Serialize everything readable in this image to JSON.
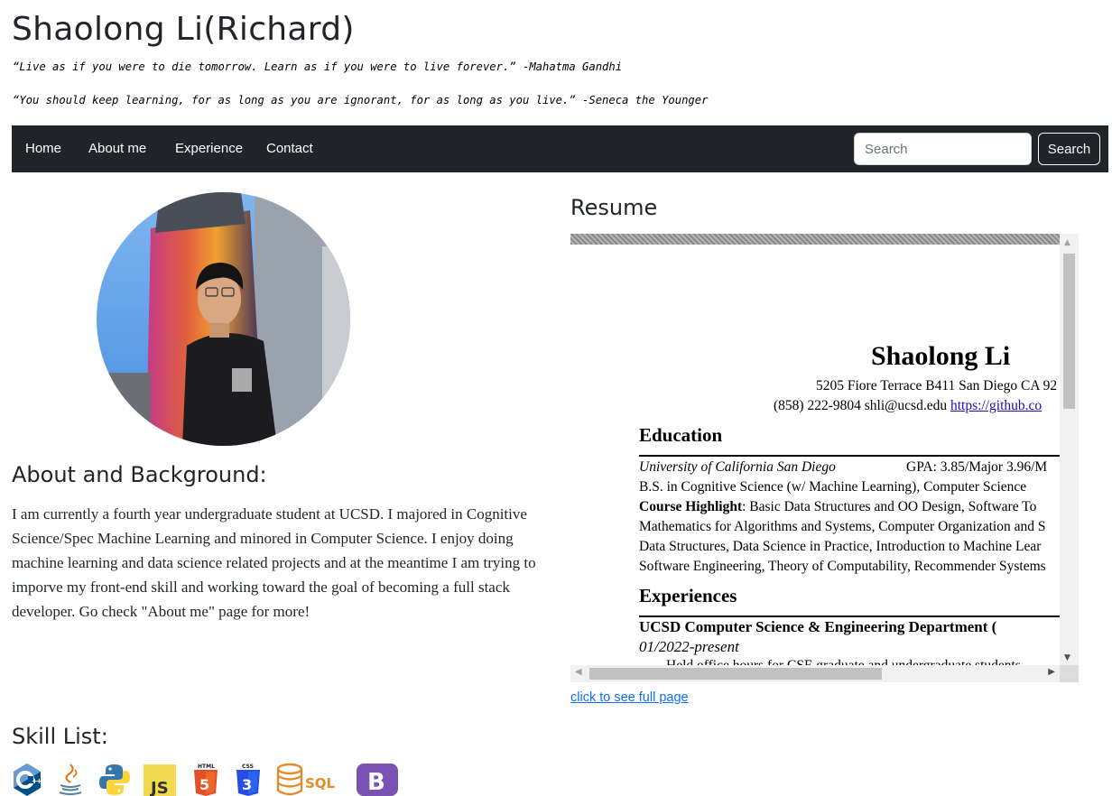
{
  "header": {
    "title": "Shaolong Li(Richard)",
    "quote1": "“Live as if you were to die tomorrow. Learn as if you were to live forever.” -Mahatma Gandhi",
    "quote2": "“You should keep learning, for as long as you are ignorant, for as long as you live.” -Seneca the Younger"
  },
  "navbar": {
    "items": [
      {
        "label": "Home"
      },
      {
        "label": "About me"
      },
      {
        "label": "Experience"
      },
      {
        "label": "Contact"
      }
    ],
    "search_placeholder": "Search",
    "search_value": "",
    "search_button": "Search"
  },
  "about": {
    "heading": "About and Background:",
    "text": "I am currently a fourth year undergraduate student at UCSD. I majored in Cognitive Science/Spec Machine Learning and minored in Computer Science. I enjoy doing machine learning and data science related projects and at the meantime I am trying to imporve my front-end skill and working toward the goal of becoming a full stack developer. Go check \"About me\" page for more!"
  },
  "resume": {
    "heading": "Resume",
    "doc": {
      "name": "Shaolong Li",
      "address": "5205 Fiore Terrace B411 San Diego CA 92",
      "contact": "(858) 222-9804 shli@ucsd.edu ",
      "contact_link": "https://github.co",
      "education_heading": "Education",
      "school": "University of California San Diego",
      "gpa": "GPA: 3.85/Major 3.96/M",
      "degree": "B.S. in Cognitive Science (w/ Machine Learning), Computer Science",
      "highlight_label": "Course Highlight",
      "highlight_line1": ": Basic Data Structures and OO Design, Software To",
      "highlight_line2": "Mathematics for Algorithms and Systems, Computer Organization and S",
      "highlight_line3": "Data Structures, Data Science in Practice, Introduction to Machine Lear",
      "highlight_line4": "Software Engineering, Theory of Computability, Recommender Systems",
      "experiences_heading": "Experiences",
      "job_title": "UCSD Computer Science & Engineering Department (",
      "job_date": "01/2022-present",
      "job_bullet": "Held office hours for CSE graduate and undergraduate students"
    },
    "full_page_link": "click to see full page"
  },
  "skills": {
    "heading": "Skill List:",
    "items": [
      {
        "name": "C++",
        "icon": "cplusplus-icon",
        "color": "#044f88"
      },
      {
        "name": "Java",
        "icon": "java-icon",
        "color": "#e76f00"
      },
      {
        "name": "Python",
        "icon": "python-icon",
        "color": "#3776ab"
      },
      {
        "name": "JS",
        "icon": "javascript-icon",
        "color": "#f0db4f"
      },
      {
        "name": "HTML",
        "icon": "html5-icon",
        "color": "#e34f26"
      },
      {
        "name": "CSS",
        "icon": "css3-icon",
        "color": "#264de4"
      },
      {
        "name": "SQL",
        "icon": "sql-icon",
        "color": "#e38c2c"
      },
      {
        "name": "B",
        "icon": "bootstrap-icon",
        "color": "#7952b3"
      }
    ]
  },
  "colors": {
    "navbar_bg": "#212529",
    "link": "#0d6efd"
  }
}
